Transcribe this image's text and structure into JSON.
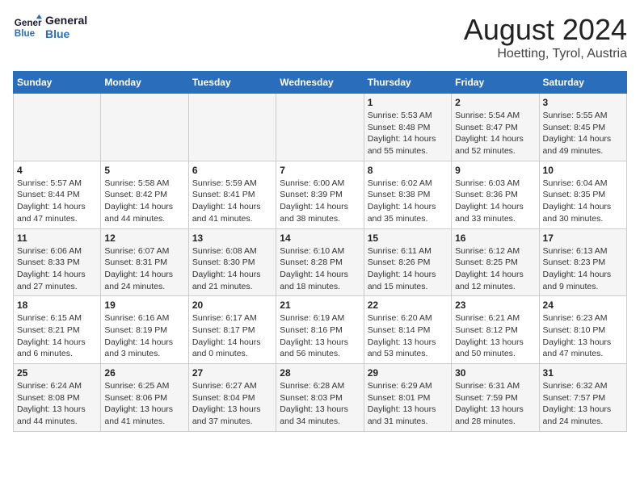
{
  "header": {
    "logo": {
      "line1": "General",
      "line2": "Blue"
    },
    "title": "August 2024",
    "subtitle": "Hoetting, Tyrol, Austria"
  },
  "weekdays": [
    "Sunday",
    "Monday",
    "Tuesday",
    "Wednesday",
    "Thursday",
    "Friday",
    "Saturday"
  ],
  "weeks": [
    [
      {
        "day": "",
        "info": ""
      },
      {
        "day": "",
        "info": ""
      },
      {
        "day": "",
        "info": ""
      },
      {
        "day": "",
        "info": ""
      },
      {
        "day": "1",
        "info": "Sunrise: 5:53 AM\nSunset: 8:48 PM\nDaylight: 14 hours\nand 55 minutes."
      },
      {
        "day": "2",
        "info": "Sunrise: 5:54 AM\nSunset: 8:47 PM\nDaylight: 14 hours\nand 52 minutes."
      },
      {
        "day": "3",
        "info": "Sunrise: 5:55 AM\nSunset: 8:45 PM\nDaylight: 14 hours\nand 49 minutes."
      }
    ],
    [
      {
        "day": "4",
        "info": "Sunrise: 5:57 AM\nSunset: 8:44 PM\nDaylight: 14 hours\nand 47 minutes."
      },
      {
        "day": "5",
        "info": "Sunrise: 5:58 AM\nSunset: 8:42 PM\nDaylight: 14 hours\nand 44 minutes."
      },
      {
        "day": "6",
        "info": "Sunrise: 5:59 AM\nSunset: 8:41 PM\nDaylight: 14 hours\nand 41 minutes."
      },
      {
        "day": "7",
        "info": "Sunrise: 6:00 AM\nSunset: 8:39 PM\nDaylight: 14 hours\nand 38 minutes."
      },
      {
        "day": "8",
        "info": "Sunrise: 6:02 AM\nSunset: 8:38 PM\nDaylight: 14 hours\nand 35 minutes."
      },
      {
        "day": "9",
        "info": "Sunrise: 6:03 AM\nSunset: 8:36 PM\nDaylight: 14 hours\nand 33 minutes."
      },
      {
        "day": "10",
        "info": "Sunrise: 6:04 AM\nSunset: 8:35 PM\nDaylight: 14 hours\nand 30 minutes."
      }
    ],
    [
      {
        "day": "11",
        "info": "Sunrise: 6:06 AM\nSunset: 8:33 PM\nDaylight: 14 hours\nand 27 minutes."
      },
      {
        "day": "12",
        "info": "Sunrise: 6:07 AM\nSunset: 8:31 PM\nDaylight: 14 hours\nand 24 minutes."
      },
      {
        "day": "13",
        "info": "Sunrise: 6:08 AM\nSunset: 8:30 PM\nDaylight: 14 hours\nand 21 minutes."
      },
      {
        "day": "14",
        "info": "Sunrise: 6:10 AM\nSunset: 8:28 PM\nDaylight: 14 hours\nand 18 minutes."
      },
      {
        "day": "15",
        "info": "Sunrise: 6:11 AM\nSunset: 8:26 PM\nDaylight: 14 hours\nand 15 minutes."
      },
      {
        "day": "16",
        "info": "Sunrise: 6:12 AM\nSunset: 8:25 PM\nDaylight: 14 hours\nand 12 minutes."
      },
      {
        "day": "17",
        "info": "Sunrise: 6:13 AM\nSunset: 8:23 PM\nDaylight: 14 hours\nand 9 minutes."
      }
    ],
    [
      {
        "day": "18",
        "info": "Sunrise: 6:15 AM\nSunset: 8:21 PM\nDaylight: 14 hours\nand 6 minutes."
      },
      {
        "day": "19",
        "info": "Sunrise: 6:16 AM\nSunset: 8:19 PM\nDaylight: 14 hours\nand 3 minutes."
      },
      {
        "day": "20",
        "info": "Sunrise: 6:17 AM\nSunset: 8:17 PM\nDaylight: 14 hours\nand 0 minutes."
      },
      {
        "day": "21",
        "info": "Sunrise: 6:19 AM\nSunset: 8:16 PM\nDaylight: 13 hours\nand 56 minutes."
      },
      {
        "day": "22",
        "info": "Sunrise: 6:20 AM\nSunset: 8:14 PM\nDaylight: 13 hours\nand 53 minutes."
      },
      {
        "day": "23",
        "info": "Sunrise: 6:21 AM\nSunset: 8:12 PM\nDaylight: 13 hours\nand 50 minutes."
      },
      {
        "day": "24",
        "info": "Sunrise: 6:23 AM\nSunset: 8:10 PM\nDaylight: 13 hours\nand 47 minutes."
      }
    ],
    [
      {
        "day": "25",
        "info": "Sunrise: 6:24 AM\nSunset: 8:08 PM\nDaylight: 13 hours\nand 44 minutes."
      },
      {
        "day": "26",
        "info": "Sunrise: 6:25 AM\nSunset: 8:06 PM\nDaylight: 13 hours\nand 41 minutes."
      },
      {
        "day": "27",
        "info": "Sunrise: 6:27 AM\nSunset: 8:04 PM\nDaylight: 13 hours\nand 37 minutes."
      },
      {
        "day": "28",
        "info": "Sunrise: 6:28 AM\nSunset: 8:03 PM\nDaylight: 13 hours\nand 34 minutes."
      },
      {
        "day": "29",
        "info": "Sunrise: 6:29 AM\nSunset: 8:01 PM\nDaylight: 13 hours\nand 31 minutes."
      },
      {
        "day": "30",
        "info": "Sunrise: 6:31 AM\nSunset: 7:59 PM\nDaylight: 13 hours\nand 28 minutes."
      },
      {
        "day": "31",
        "info": "Sunrise: 6:32 AM\nSunset: 7:57 PM\nDaylight: 13 hours\nand 24 minutes."
      }
    ]
  ]
}
